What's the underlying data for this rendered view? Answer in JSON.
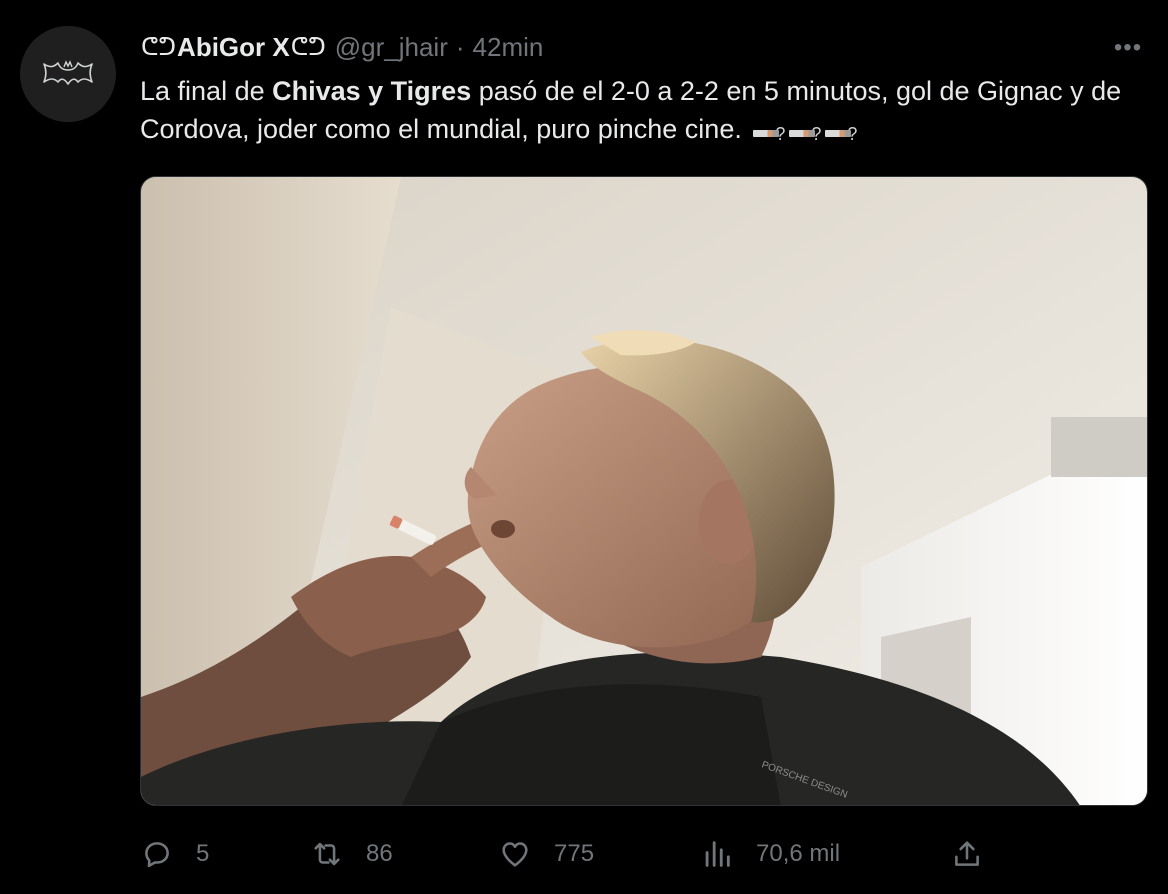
{
  "tweet": {
    "display_name": "AbiGor X",
    "name_glyph_left": "ᕦᕤ",
    "name_glyph_right": "ᕦᕤ",
    "handle": "@gr_jhair",
    "separator": "·",
    "time": "42min",
    "more_label": "•••",
    "text": {
      "part1": "La final de ",
      "bold": "Chivas y Tigres",
      "part2": " pasó de el 2-0 a 2-2 en 5 minutos, gol de Gignac y de Cordova, joder como el mundial, puro pinche cine.",
      "emoji_1": "?",
      "emoji_2": "?",
      "emoji_3": "?"
    },
    "media_icon": "man-smoking-photo"
  },
  "actions": {
    "reply_count": "5",
    "retweet_count": "86",
    "like_count": "775",
    "views_count": "70,6 mil"
  },
  "icons": {
    "reply": "reply-icon",
    "retweet": "retweet-icon",
    "like": "heart-icon",
    "views": "views-icon",
    "share": "share-icon",
    "avatar": "bat-logo-icon"
  },
  "colors": {
    "background": "#000000",
    "text": "#e7e9ea",
    "secondary": "#71767b"
  }
}
